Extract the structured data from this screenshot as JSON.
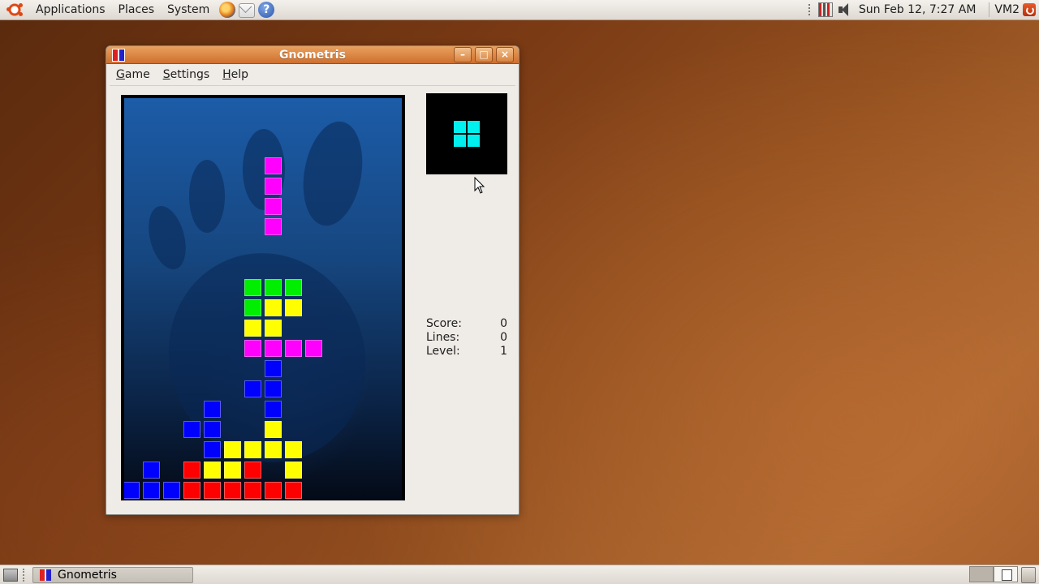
{
  "top_panel": {
    "menus": [
      "Applications",
      "Places",
      "System"
    ],
    "clock": "Sun Feb 12,  7:27 AM",
    "user": "VM2"
  },
  "window": {
    "title": "Gnometris",
    "menus": [
      {
        "label": "Game",
        "mnemonic": "G",
        "rest": "ame"
      },
      {
        "label": "Settings",
        "mnemonic": "S",
        "rest": "ettings"
      },
      {
        "label": "Help",
        "mnemonic": "H",
        "rest": "elp"
      }
    ],
    "stats": [
      {
        "label": "Score:",
        "value": "0"
      },
      {
        "label": "Lines:",
        "value": "0"
      },
      {
        "label": "Level:",
        "value": "1"
      }
    ],
    "next_piece": {
      "color": "#00f0f0",
      "shape": "O"
    },
    "board": {
      "cols": 14,
      "cell_colors": {
        "M": "#ff00ff",
        "G": "#00ee00",
        "Y": "#ffff00",
        "B": "#0000ff",
        "R": "#ff0000"
      },
      "cells": [
        {
          "col": 7,
          "row": 3,
          "c": "M"
        },
        {
          "col": 7,
          "row": 4,
          "c": "M"
        },
        {
          "col": 7,
          "row": 5,
          "c": "M"
        },
        {
          "col": 7,
          "row": 6,
          "c": "M"
        },
        {
          "col": 6,
          "row": 9,
          "c": "G"
        },
        {
          "col": 7,
          "row": 9,
          "c": "G"
        },
        {
          "col": 8,
          "row": 9,
          "c": "G"
        },
        {
          "col": 6,
          "row": 10,
          "c": "G"
        },
        {
          "col": 7,
          "row": 10,
          "c": "Y"
        },
        {
          "col": 8,
          "row": 10,
          "c": "Y"
        },
        {
          "col": 6,
          "row": 11,
          "c": "Y"
        },
        {
          "col": 7,
          "row": 11,
          "c": "Y"
        },
        {
          "col": 6,
          "row": 12,
          "c": "M"
        },
        {
          "col": 7,
          "row": 12,
          "c": "M"
        },
        {
          "col": 8,
          "row": 12,
          "c": "M"
        },
        {
          "col": 9,
          "row": 12,
          "c": "M"
        },
        {
          "col": 7,
          "row": 13,
          "c": "B"
        },
        {
          "col": 6,
          "row": 14,
          "c": "B"
        },
        {
          "col": 7,
          "row": 14,
          "c": "B"
        },
        {
          "col": 4,
          "row": 15,
          "c": "B"
        },
        {
          "col": 7,
          "row": 15,
          "c": "B"
        },
        {
          "col": 3,
          "row": 16,
          "c": "B"
        },
        {
          "col": 4,
          "row": 16,
          "c": "B"
        },
        {
          "col": 7,
          "row": 16,
          "c": "Y"
        },
        {
          "col": 4,
          "row": 17,
          "c": "B"
        },
        {
          "col": 5,
          "row": 17,
          "c": "Y"
        },
        {
          "col": 6,
          "row": 17,
          "c": "Y"
        },
        {
          "col": 7,
          "row": 17,
          "c": "Y"
        },
        {
          "col": 8,
          "row": 17,
          "c": "Y"
        },
        {
          "col": 1,
          "row": 18,
          "c": "B"
        },
        {
          "col": 3,
          "row": 18,
          "c": "R"
        },
        {
          "col": 4,
          "row": 18,
          "c": "Y"
        },
        {
          "col": 5,
          "row": 18,
          "c": "Y"
        },
        {
          "col": 6,
          "row": 18,
          "c": "R"
        },
        {
          "col": 8,
          "row": 18,
          "c": "Y"
        },
        {
          "col": 0,
          "row": 19,
          "c": "B"
        },
        {
          "col": 1,
          "row": 19,
          "c": "B"
        },
        {
          "col": 2,
          "row": 19,
          "c": "B"
        },
        {
          "col": 3,
          "row": 19,
          "c": "R"
        },
        {
          "col": 4,
          "row": 19,
          "c": "R"
        },
        {
          "col": 5,
          "row": 19,
          "c": "R"
        },
        {
          "col": 6,
          "row": 19,
          "c": "R"
        },
        {
          "col": 7,
          "row": 19,
          "c": "R"
        },
        {
          "col": 8,
          "row": 19,
          "c": "R"
        }
      ]
    }
  },
  "taskbar": {
    "task_label": "Gnometris"
  }
}
